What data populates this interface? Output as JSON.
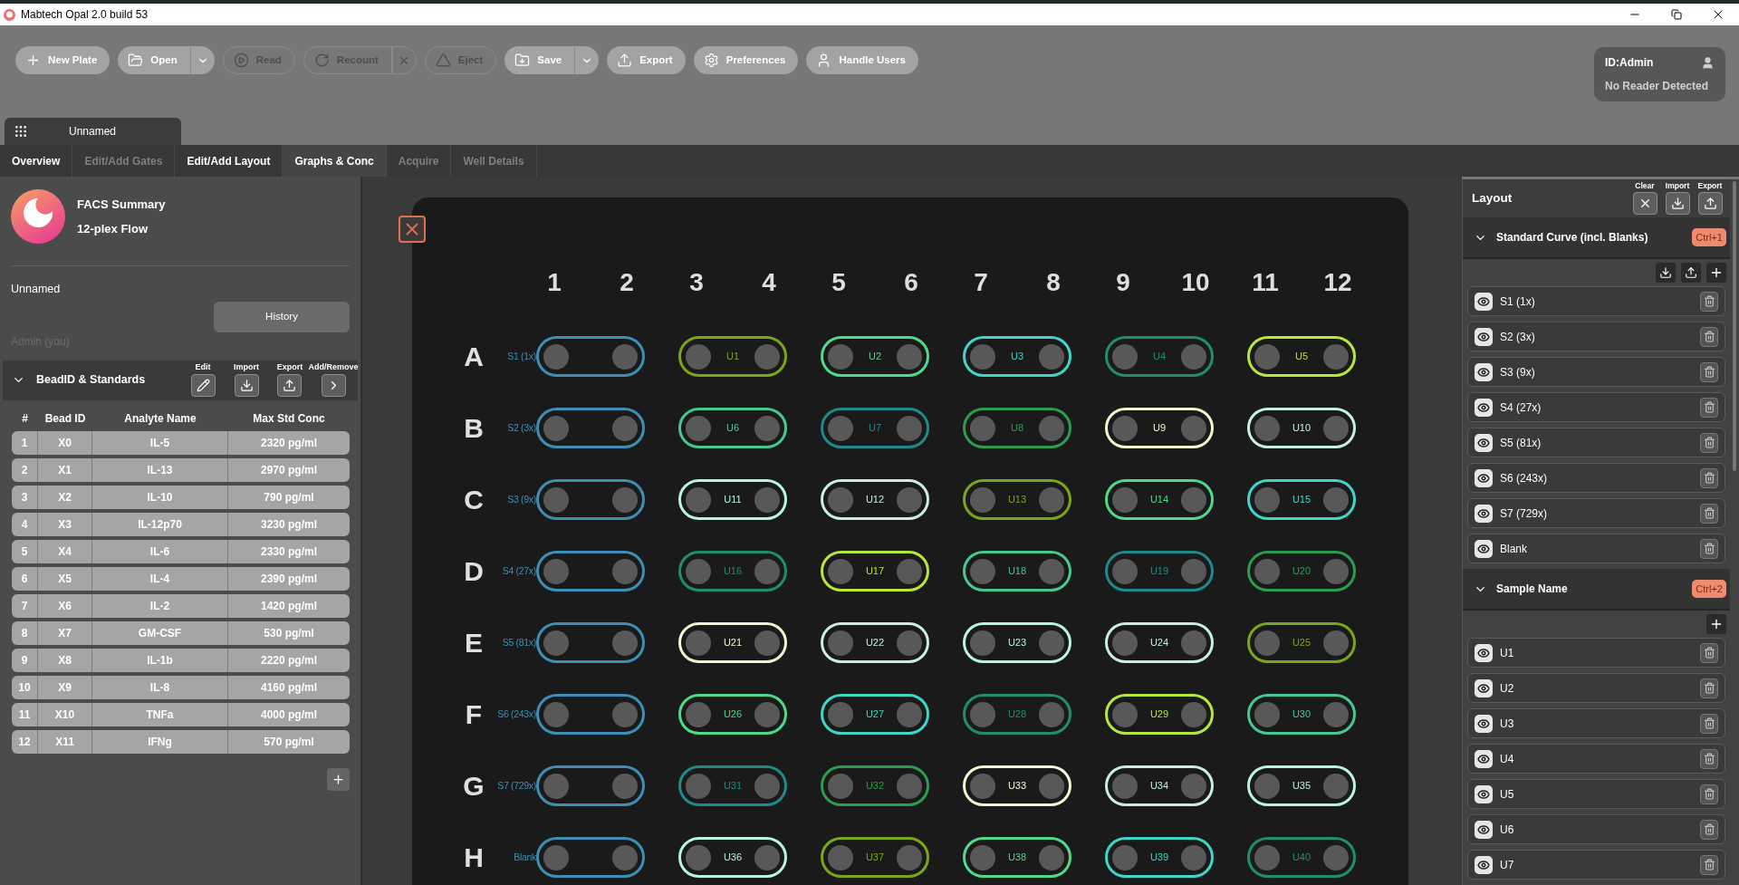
{
  "window": {
    "title": "Mabtech Opal 2.0 build 53"
  },
  "toolbar": [
    {
      "label": "New Plate",
      "kind": "button",
      "disabled": false
    },
    {
      "label": "Open",
      "kind": "split",
      "disabled": false
    },
    {
      "label": "Read",
      "kind": "button",
      "disabled": true
    },
    {
      "label": "Recount",
      "kind": "cancel",
      "disabled": true
    },
    {
      "label": "Eject",
      "kind": "button",
      "disabled": true
    },
    {
      "label": "Save",
      "kind": "split",
      "disabled": false
    },
    {
      "label": "Export",
      "kind": "button",
      "disabled": false
    },
    {
      "label": "Preferences",
      "kind": "button",
      "disabled": false
    },
    {
      "label": "Handle Users",
      "kind": "button",
      "disabled": false
    }
  ],
  "user": {
    "id": "ID:Admin",
    "status": "No Reader Detected"
  },
  "plate_tab": {
    "label": "Unnamed"
  },
  "tabs": [
    {
      "label": "Overview",
      "selected": false,
      "disabled": false
    },
    {
      "label": "Edit/Add Gates",
      "selected": false,
      "disabled": true
    },
    {
      "label": "Edit/Add Layout",
      "selected": false,
      "disabled": false
    },
    {
      "label": "Graphs & Conc",
      "selected": true,
      "disabled": false
    },
    {
      "label": "Acquire",
      "selected": false,
      "disabled": true
    },
    {
      "label": "Well Details",
      "selected": false,
      "disabled": true
    }
  ],
  "summary": {
    "title": "FACS Summary",
    "subtitle": "12-plex Flow",
    "name": "Unnamed",
    "history_button": "History",
    "owner": "Admin (you)"
  },
  "beads": {
    "title": "BeadID & Standards",
    "expanded": true,
    "actions": [
      {
        "label": "Edit"
      },
      {
        "label": "Import"
      },
      {
        "label": "Export"
      },
      {
        "label": "Add/Remove"
      }
    ],
    "columns": [
      "#",
      "Bead ID",
      "Analyte Name",
      "Max Std Conc"
    ],
    "rows": [
      [
        "1",
        "X0",
        "IL-5",
        "2320 pg/ml"
      ],
      [
        "2",
        "X1",
        "IL-13",
        "2970 pg/ml"
      ],
      [
        "3",
        "X2",
        "IL-10",
        "790 pg/ml"
      ],
      [
        "4",
        "X3",
        "IL-12p70",
        "3230 pg/ml"
      ],
      [
        "5",
        "X4",
        "IL-6",
        "2330 pg/ml"
      ],
      [
        "6",
        "X5",
        "IL-4",
        "2390 pg/ml"
      ],
      [
        "7",
        "X6",
        "IL-2",
        "1420 pg/ml"
      ],
      [
        "8",
        "X7",
        "GM-CSF",
        "530 pg/ml"
      ],
      [
        "9",
        "X8",
        "IL-1b",
        "2220 pg/ml"
      ],
      [
        "10",
        "X9",
        "IL-8",
        "4160 pg/ml"
      ],
      [
        "11",
        "X10",
        "TNFa",
        "4000 pg/ml"
      ],
      [
        "12",
        "X11",
        "IFNg",
        "570 pg/ml"
      ]
    ]
  },
  "plate": {
    "columns": [
      "1",
      "2",
      "3",
      "4",
      "5",
      "6",
      "7",
      "8",
      "9",
      "10",
      "11",
      "12"
    ],
    "rows": [
      {
        "letter": "A",
        "standard": {
          "label": "S1 (1x)",
          "color": "#3d8fb5"
        },
        "wells": [
          {
            "label": "U1",
            "color": "#7aa61a"
          },
          {
            "label": "U2",
            "color": "#4fd98a"
          },
          {
            "label": "U3",
            "color": "#3dd6c8"
          },
          {
            "label": "U4",
            "color": "#1f8f6a"
          },
          {
            "label": "U5",
            "color": "#b5e83a"
          }
        ]
      },
      {
        "letter": "B",
        "standard": {
          "label": "S2 (3x)",
          "color": "#3d8fb5"
        },
        "wells": [
          {
            "label": "U6",
            "color": "#45c990"
          },
          {
            "label": "U7",
            "color": "#1f8a8a"
          },
          {
            "label": "U8",
            "color": "#2a9d4f"
          },
          {
            "label": "U9",
            "color": "#f5f5d0"
          },
          {
            "label": "U10",
            "color": "#c8f0dc"
          }
        ]
      },
      {
        "letter": "C",
        "standard": {
          "label": "S3 (9x)",
          "color": "#3d8fb5"
        },
        "wells": [
          {
            "label": "U11",
            "color": "#b8f5e0"
          },
          {
            "label": "U12",
            "color": "#c8f0dc"
          },
          {
            "label": "U13",
            "color": "#7aa61a"
          },
          {
            "label": "U14",
            "color": "#4fd98a"
          },
          {
            "label": "U15",
            "color": "#3dd6c8"
          }
        ]
      },
      {
        "letter": "D",
        "standard": {
          "label": "S4 (27x)",
          "color": "#3d8fb5"
        },
        "wells": [
          {
            "label": "U16",
            "color": "#1f8f6a"
          },
          {
            "label": "U17",
            "color": "#b5e83a"
          },
          {
            "label": "U18",
            "color": "#45c990"
          },
          {
            "label": "U19",
            "color": "#1f8a8a"
          },
          {
            "label": "U20",
            "color": "#2a9d4f"
          }
        ]
      },
      {
        "letter": "E",
        "standard": {
          "label": "S5 (81x)",
          "color": "#3d8fb5"
        },
        "wells": [
          {
            "label": "U21",
            "color": "#f5f5d0"
          },
          {
            "label": "U22",
            "color": "#c8f0dc"
          },
          {
            "label": "U23",
            "color": "#b8f5e0"
          },
          {
            "label": "U24",
            "color": "#c8f0dc"
          },
          {
            "label": "U25",
            "color": "#7aa61a"
          }
        ]
      },
      {
        "letter": "F",
        "standard": {
          "label": "S6 (243x)",
          "color": "#3d8fb5"
        },
        "wells": [
          {
            "label": "U26",
            "color": "#4fd98a"
          },
          {
            "label": "U27",
            "color": "#3dd6c8"
          },
          {
            "label": "U28",
            "color": "#1f8f6a"
          },
          {
            "label": "U29",
            "color": "#b5e83a"
          },
          {
            "label": "U30",
            "color": "#45c990"
          }
        ]
      },
      {
        "letter": "G",
        "standard": {
          "label": "S7 (729x)",
          "color": "#3d8fb5"
        },
        "wells": [
          {
            "label": "U31",
            "color": "#1f8a8a"
          },
          {
            "label": "U32",
            "color": "#2a9d4f"
          },
          {
            "label": "U33",
            "color": "#f5f5d0"
          },
          {
            "label": "U34",
            "color": "#c8f0dc"
          },
          {
            "label": "U35",
            "color": "#b8f5e0"
          }
        ]
      },
      {
        "letter": "H",
        "standard": {
          "label": "Blank",
          "color": "#3d8fb5"
        },
        "wells": [
          {
            "label": "U36",
            "color": "#b8f5e0"
          },
          {
            "label": "U37",
            "color": "#7aa61a"
          },
          {
            "label": "U38",
            "color": "#4fd98a"
          },
          {
            "label": "U39",
            "color": "#3dd6c8"
          },
          {
            "label": "U40",
            "color": "#1f8f6a"
          }
        ]
      }
    ]
  },
  "layout_panel": {
    "title": "Layout",
    "actions": [
      {
        "label": "Clear"
      },
      {
        "label": "Import"
      },
      {
        "label": "Export"
      }
    ],
    "sections": [
      {
        "title": "Standard Curve (incl. Blanks)",
        "shortcut": "Ctrl+1",
        "kind": "standards",
        "expanded": true,
        "items": [
          {
            "label": "S1 (1x)"
          },
          {
            "label": "S2 (3x)"
          },
          {
            "label": "S3 (9x)"
          },
          {
            "label": "S4 (27x)"
          },
          {
            "label": "S5 (81x)"
          },
          {
            "label": "S6 (243x)"
          },
          {
            "label": "S7 (729x)"
          },
          {
            "label": "Blank"
          }
        ]
      },
      {
        "title": "Sample Name",
        "shortcut": "Ctrl+2",
        "kind": "samples",
        "expanded": true,
        "items": [
          {
            "label": "U1"
          },
          {
            "label": "U2"
          },
          {
            "label": "U3"
          },
          {
            "label": "U4"
          },
          {
            "label": "U5"
          },
          {
            "label": "U6"
          },
          {
            "label": "U7"
          }
        ]
      }
    ]
  }
}
